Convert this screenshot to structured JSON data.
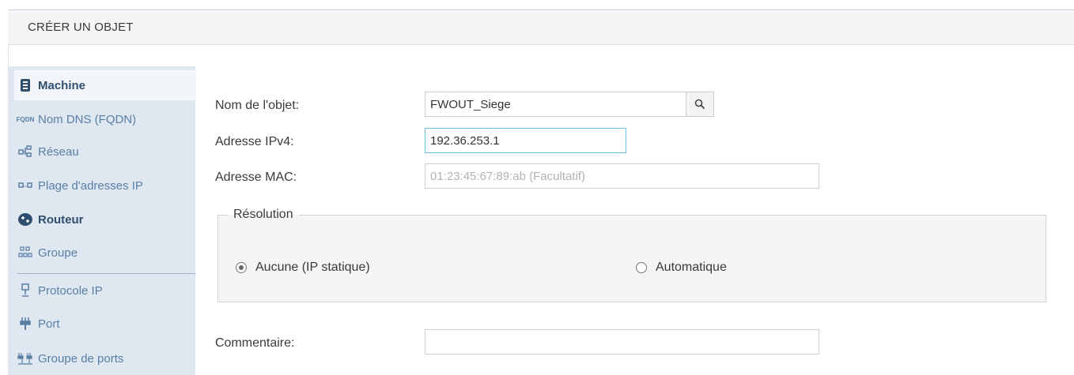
{
  "header": {
    "title": "CRÉER UN OBJET"
  },
  "sidebar": {
    "items": [
      {
        "label": "Machine",
        "icon": "machine-icon"
      },
      {
        "label": "Nom DNS (FQDN)",
        "icon": "fqdn-icon"
      },
      {
        "label": "Réseau",
        "icon": "network-icon"
      },
      {
        "label": "Plage d'adresses IP",
        "icon": "ip-range-icon"
      },
      {
        "label": "Routeur",
        "icon": "router-icon"
      },
      {
        "label": "Groupe",
        "icon": "group-icon"
      },
      {
        "label": "Protocole IP",
        "icon": "ip-protocol-icon"
      },
      {
        "label": "Port",
        "icon": "port-icon"
      },
      {
        "label": "Groupe de ports",
        "icon": "port-group-icon"
      }
    ],
    "selected": "Machine",
    "fqdn_badge": "FQDN"
  },
  "form": {
    "name_label": "Nom de l'objet:",
    "name_value": "FWOUT_Siege",
    "ipv4_label": "Adresse IPv4:",
    "ipv4_value": "192.36.253.1",
    "mac_label": "Adresse MAC:",
    "mac_placeholder": "01:23:45:67:89:ab (Facultatif)",
    "comment_label": "Commentaire:",
    "comment_value": ""
  },
  "resolution": {
    "legend": "Résolution",
    "options": [
      {
        "label": "Aucune (IP statique)",
        "checked": true
      },
      {
        "label": "Automatique",
        "checked": false
      }
    ]
  },
  "colors": {
    "sidebar_bg": "#dfe7f1",
    "sidebar_text": "#5a7fa6",
    "focus_border": "#6ec3e6"
  }
}
